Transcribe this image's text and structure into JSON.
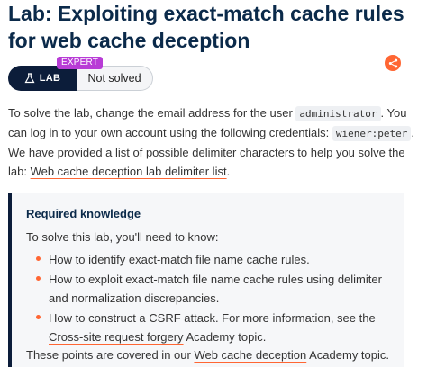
{
  "header": {
    "title": "Lab: Exploiting exact-match cache rules for web cache deception"
  },
  "status": {
    "lab_label": "LAB",
    "level_badge": "EXPERT",
    "status_text": "Not solved"
  },
  "colors": {
    "accent": "#ff6633",
    "navy": "#0c1d3a",
    "expert": "#b83cd6"
  },
  "share": {
    "icon": "share-icon"
  },
  "intro": {
    "p1_before": "To solve the lab, change the email address for the user ",
    "user_code": "administrator",
    "p1_middle": ". You can log in to your own account using the following credentials: ",
    "creds_code": "wiener:peter",
    "p1_after": ".",
    "p2_text": "We have provided a list of possible delimiter characters to help you solve the lab: ",
    "p2_link": "Web cache deception lab delimiter list",
    "p2_after": "."
  },
  "knowledge": {
    "heading": "Required knowledge",
    "intro": "To solve this lab, you'll need to know:",
    "items": [
      {
        "text": "How to identify exact-match file name cache rules."
      },
      {
        "text": "How to exploit exact-match file name cache rules using delimiter and normalization discrepancies."
      },
      {
        "before": "How to construct a CSRF attack. For more information, see the ",
        "link": "Cross-site request forgery",
        "after": " Academy topic."
      }
    ],
    "footer_before": "These points are covered in our ",
    "footer_link": "Web cache deception",
    "footer_after": " Academy topic."
  }
}
